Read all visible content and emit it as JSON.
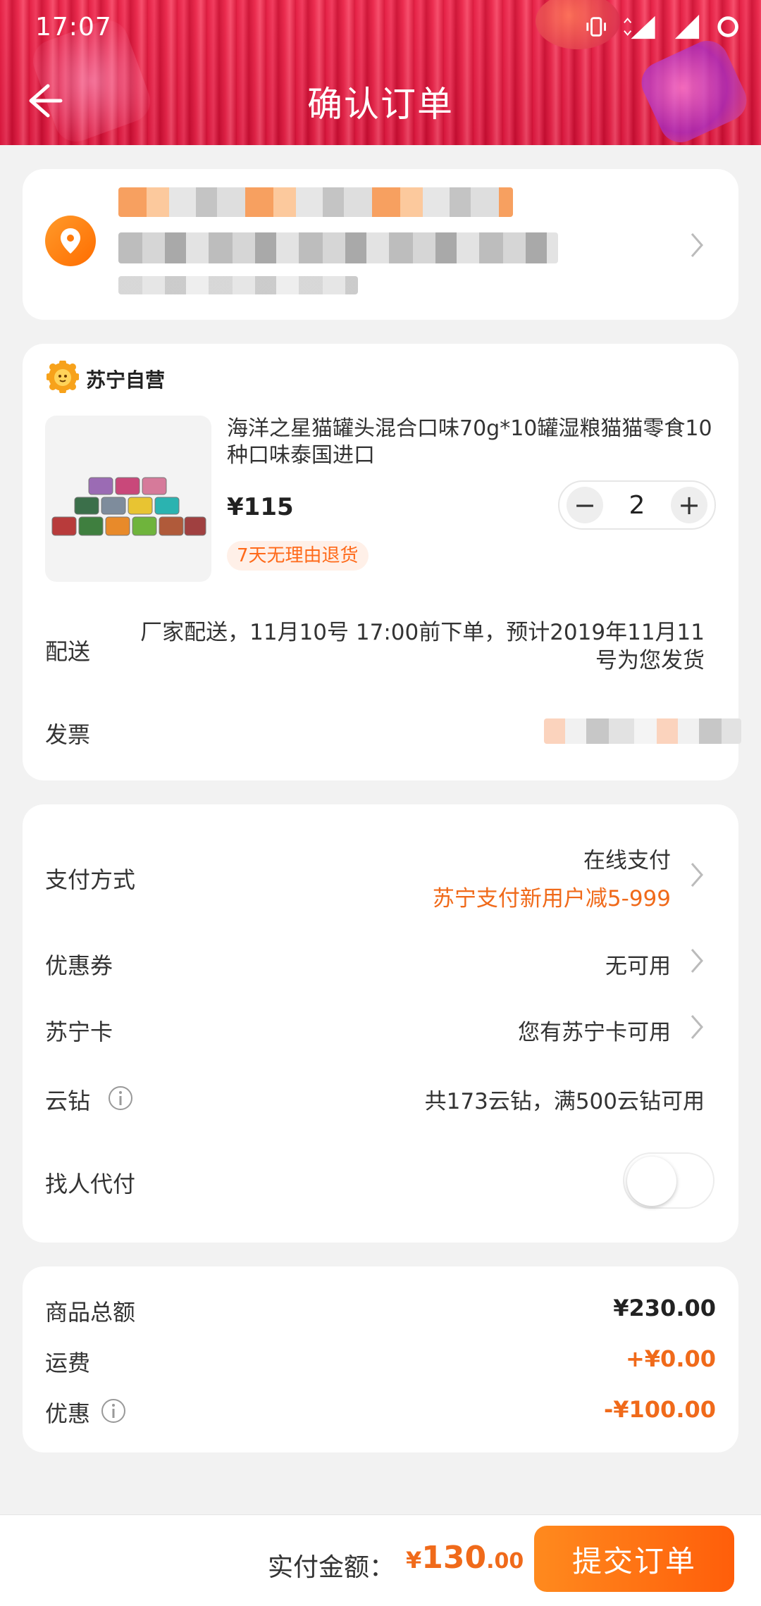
{
  "status_bar": {
    "time": "17:07",
    "network": "4G"
  },
  "header": {
    "title": "确认订单"
  },
  "store": {
    "name": "苏宁自营"
  },
  "product": {
    "title": "海洋之星猫罐头混合口味70g*10罐湿粮猫猫零食10种口味泰国进口",
    "price": "¥115",
    "quantity": "2",
    "minus": "−",
    "plus": "+",
    "return_badge": "7天无理由退货"
  },
  "delivery": {
    "label": "配送",
    "value": "厂家配送，11月10号 17:00前下单，预计2019年11月11号为您发货"
  },
  "invoice": {
    "label": "发票"
  },
  "payment": {
    "method_label": "支付方式",
    "method_value": "在线支付",
    "promo": "苏宁支付新用户减5-999",
    "coupon_label": "优惠券",
    "coupon_value": "无可用",
    "card_label": "苏宁卡",
    "card_value": "您有苏宁卡可用",
    "yunzuan_label": "云钻",
    "yunzuan_value": "共173云钻，满500云钻可用",
    "proxy_label": "找人代付",
    "proxy_enabled": false
  },
  "summary": {
    "goods_label": "商品总额",
    "goods_value": "¥230.00",
    "freight_label": "运费",
    "freight_value": "+¥0.00",
    "discount_label": "优惠",
    "discount_value": "-¥100.00"
  },
  "footer": {
    "total_label": "实付金额：",
    "currency": "¥",
    "total_int": "130",
    "total_dec": ".00",
    "submit_label": "提交订单"
  },
  "colors": {
    "accent": "#f06a1a",
    "header": "#e01940",
    "button": "#ff6a0f"
  }
}
